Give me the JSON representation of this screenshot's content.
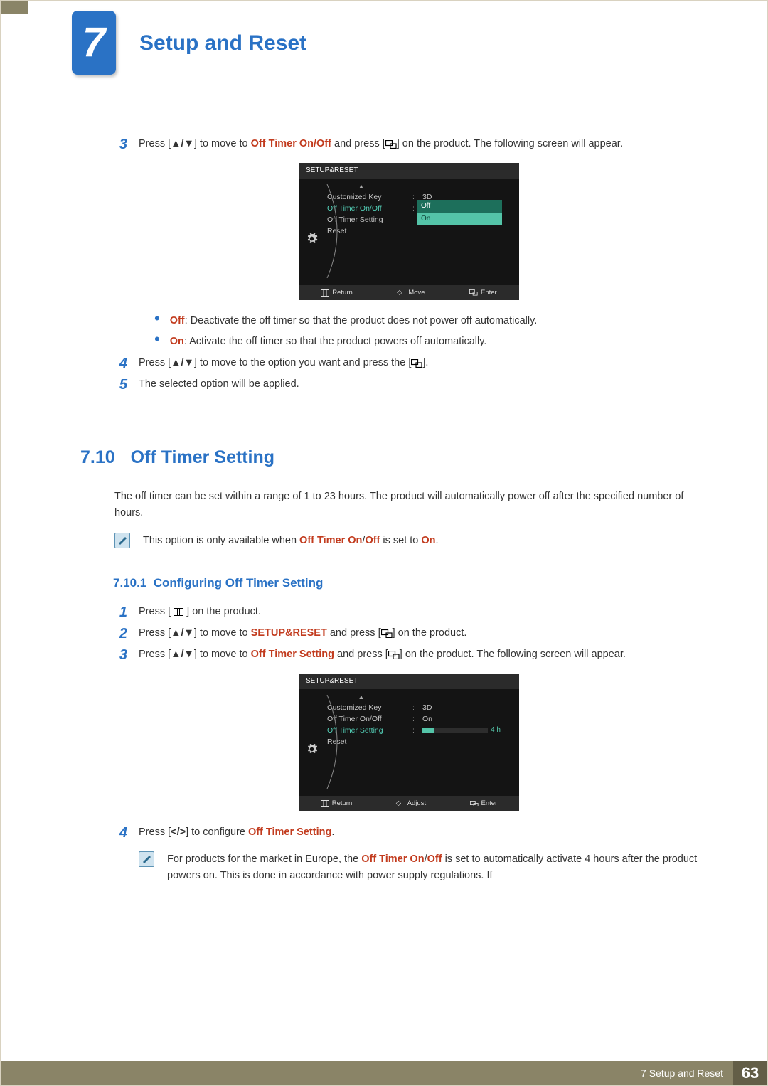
{
  "chapter": {
    "number": "7",
    "title": "Setup and Reset"
  },
  "steps_top": {
    "s3_a": "Press [",
    "s3_b": "] to move to ",
    "s3_kw": "Off Timer On/Off",
    "s3_c": " and press [",
    "s3_d": "] on the product. The following screen will appear.",
    "s4_a": "Press [",
    "s4_b": "] to move to the option you want and press the [",
    "s4_c": "].",
    "s5": "The selected option will be applied.",
    "nums": {
      "s3": "3",
      "s4": "4",
      "s5": "5"
    }
  },
  "osd1": {
    "title": "SETUP&RESET",
    "rows": {
      "r1_label": "Customized Key",
      "r1_val": "3D",
      "r2_label": "Off Timer On/Off",
      "r3_label": "Off Timer Setting",
      "r4_label": "Reset"
    },
    "dropdown": {
      "opt1": "Off",
      "opt2": "On"
    },
    "footer": {
      "return": "Return",
      "move": "Move",
      "enter": "Enter"
    }
  },
  "bullets": {
    "off_kw": "Off",
    "off_text": ": Deactivate the off timer so that the product does not power off automatically.",
    "on_kw": "On",
    "on_text": ": Activate the off timer so that the product powers off automatically."
  },
  "section": {
    "num": "7.10",
    "title": "Off Timer Setting",
    "intro": "The off timer can be set within a range of 1 to 23 hours. The product will automatically power off after the specified number of hours.",
    "note_a": "This option is only available when ",
    "note_kw1": "Off Timer On",
    "note_slash": "/",
    "note_kw2": "Off",
    "note_b": " is set to ",
    "note_kw3": "On",
    "note_c": "."
  },
  "subsection": {
    "num": "7.10.1",
    "title": "Configuring Off Timer Setting"
  },
  "steps_bottom": {
    "nums": {
      "s1": "1",
      "s2": "2",
      "s3": "3",
      "s4": "4"
    },
    "s1_a": "Press [ ",
    "s1_b": " ] on the product.",
    "s2_a": "Press [",
    "s2_b": "] to move to ",
    "s2_kw": "SETUP&RESET",
    "s2_c": " and press [",
    "s2_d": "] on the product.",
    "s3_a": "Press [",
    "s3_b": "] to move to ",
    "s3_kw": "Off Timer Setting",
    "s3_c": " and press [",
    "s3_d": "] on the product. The following screen will appear.",
    "s4_a": "Press [",
    "s4_b": "] to configure ",
    "s4_kw": "Off Timer Setting",
    "s4_c": "."
  },
  "osd2": {
    "title": "SETUP&RESET",
    "rows": {
      "r1_label": "Customized Key",
      "r1_val": "3D",
      "r2_label": "Off Timer On/Off",
      "r2_val": "On",
      "r3_label": "Off Timer Setting",
      "r4_label": "Reset"
    },
    "slider_val": "4 h",
    "footer": {
      "return": "Return",
      "adjust": "Adjust",
      "enter": "Enter"
    }
  },
  "note2": {
    "a": "For products for the market in Europe, the ",
    "kw1": "Off Timer On",
    "slash": "/",
    "kw2": "Off",
    "b": " is set to automatically activate 4 hours after the product powers on. This is done in accordance with power supply regulations. If"
  },
  "footer": {
    "text": "7 Setup and Reset",
    "page": "63"
  }
}
